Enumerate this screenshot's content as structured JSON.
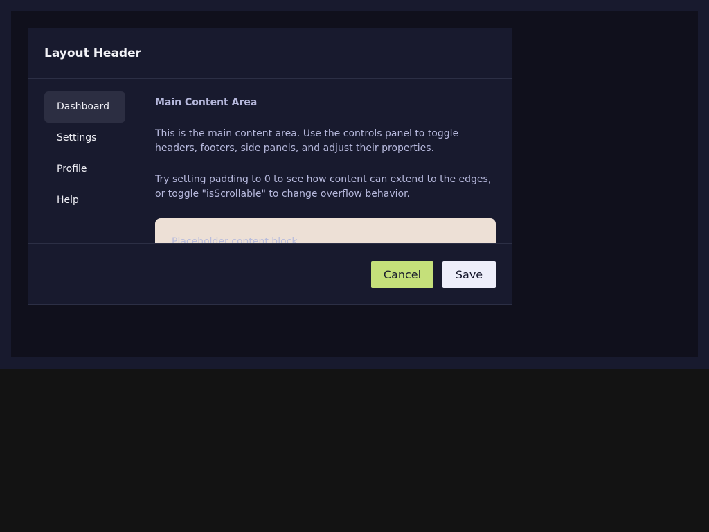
{
  "header": {
    "title": "Layout Header"
  },
  "side_panel": {
    "items": [
      {
        "label": "Dashboard",
        "active": true
      },
      {
        "label": "Settings",
        "active": false
      },
      {
        "label": "Profile",
        "active": false
      },
      {
        "label": "Help",
        "active": false
      }
    ]
  },
  "main": {
    "title": "Main Content Area",
    "paragraphs": [
      "This is the main content area. Use the controls panel to toggle headers, footers, side panels, and adjust their properties.",
      "Try setting padding to 0 to see how content can extend to the edges, or toggle \"isScrollable\" to change overflow behavior."
    ],
    "placeholder_text": "Placeholder content block"
  },
  "footer": {
    "cancel_label": "Cancel",
    "save_label": "Save"
  },
  "colors": {
    "accent": "#c5e07a",
    "surface": "#181a2e",
    "placeholder_block": "#ede0d6"
  }
}
